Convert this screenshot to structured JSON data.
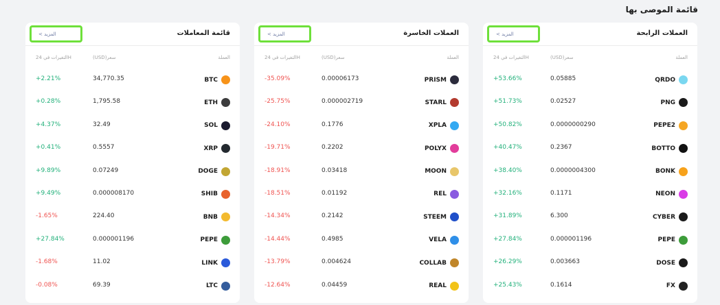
{
  "page_title": "قائمة الموصى بها",
  "panels": [
    {
      "title": "العملات الرابحة",
      "more_label": "< المزيد",
      "col_coin": "العملة",
      "col_price": "(USD)سعر",
      "col_change": "التغيرات في 24H",
      "rows": [
        {
          "symbol": "QRDO",
          "price": "0.05885",
          "change": "+53.66%",
          "dir": "pos",
          "icon": "qrdo-icon",
          "color": "#7ad7f0"
        },
        {
          "symbol": "PNG",
          "price": "0.02527",
          "change": "+51.73%",
          "dir": "pos",
          "icon": "png-icon",
          "color": "#1a1a1a"
        },
        {
          "symbol": "PEPE2",
          "price": "0.0000000290",
          "change": "+50.82%",
          "dir": "pos",
          "icon": "pepe2-icon",
          "color": "#f5a623"
        },
        {
          "symbol": "BOTTO",
          "price": "0.2367",
          "change": "+40.47%",
          "dir": "pos",
          "icon": "botto-icon",
          "color": "#111111"
        },
        {
          "symbol": "BONK",
          "price": "0.0000004300",
          "change": "+38.40%",
          "dir": "pos",
          "icon": "bonk-icon",
          "color": "#f7a21b"
        },
        {
          "symbol": "NEON",
          "price": "0.1171",
          "change": "+32.16%",
          "dir": "pos",
          "icon": "neon-icon",
          "color": "#d93be6"
        },
        {
          "symbol": "CYBER",
          "price": "6.300",
          "change": "+31.89%",
          "dir": "pos",
          "icon": "cyber-icon",
          "color": "#1a1a1a"
        },
        {
          "symbol": "PEPE",
          "price": "0.000001196",
          "change": "+27.84%",
          "dir": "pos",
          "icon": "pepe-icon",
          "color": "#3d9c3a"
        },
        {
          "symbol": "DOSE",
          "price": "0.003663",
          "change": "+26.29%",
          "dir": "pos",
          "icon": "dose-icon",
          "color": "#1a1a1a"
        },
        {
          "symbol": "FX",
          "price": "0.1614",
          "change": "+25.43%",
          "dir": "pos",
          "icon": "fx-icon",
          "color": "#222222"
        }
      ]
    },
    {
      "title": "العملات الخاسرة",
      "more_label": "< المزيد",
      "col_coin": "العملة",
      "col_price": "(USD)سعر",
      "col_change": "التغيرات في 24H",
      "rows": [
        {
          "symbol": "PRISM",
          "price": "0.00006173",
          "change": "-35.09%",
          "dir": "neg",
          "icon": "prism-icon",
          "color": "#2b2b3c"
        },
        {
          "symbol": "STARL",
          "price": "0.000002719",
          "change": "-25.75%",
          "dir": "neg",
          "icon": "starl-icon",
          "color": "#b33a2e"
        },
        {
          "symbol": "XPLA",
          "price": "0.1776",
          "change": "-24.10%",
          "dir": "neg",
          "icon": "xpla-icon",
          "color": "#33a9f2"
        },
        {
          "symbol": "POLYX",
          "price": "0.2202",
          "change": "-19.71%",
          "dir": "neg",
          "icon": "polyx-icon",
          "color": "#e23d9b"
        },
        {
          "symbol": "MOON",
          "price": "0.03418",
          "change": "-18.91%",
          "dir": "neg",
          "icon": "moon-icon",
          "color": "#e8c66a"
        },
        {
          "symbol": "REL",
          "price": "0.01192",
          "change": "-18.51%",
          "dir": "neg",
          "icon": "rel-icon",
          "color": "#8a5be0"
        },
        {
          "symbol": "STEEM",
          "price": "0.2142",
          "change": "-14.34%",
          "dir": "neg",
          "icon": "steem-icon",
          "color": "#1f4fc9"
        },
        {
          "symbol": "VELA",
          "price": "0.4985",
          "change": "-14.44%",
          "dir": "neg",
          "icon": "vela-icon",
          "color": "#2f8fe8"
        },
        {
          "symbol": "COLLAB",
          "price": "0.004624",
          "change": "-13.79%",
          "dir": "neg",
          "icon": "collab-icon",
          "color": "#c0862a"
        },
        {
          "symbol": "REAL",
          "price": "0.04459",
          "change": "-12.64%",
          "dir": "neg",
          "icon": "real-icon",
          "color": "#f2c318"
        }
      ]
    },
    {
      "title": "قائمة المعاملات",
      "more_label": "< المزيد",
      "col_coin": "العملة",
      "col_price": "(USD)سعر",
      "col_change": "التغيرات في 24H",
      "rows": [
        {
          "symbol": "BTC",
          "price": "34,770.35",
          "change": "+2.21%",
          "dir": "pos",
          "icon": "btc-icon",
          "color": "#f7931a"
        },
        {
          "symbol": "ETH",
          "price": "1,795.58",
          "change": "+0.28%",
          "dir": "pos",
          "icon": "eth-icon",
          "color": "#3c3c3d"
        },
        {
          "symbol": "SOL",
          "price": "32.49",
          "change": "+4.37%",
          "dir": "pos",
          "icon": "sol-icon",
          "color": "#1a1a2e"
        },
        {
          "symbol": "XRP",
          "price": "0.5557",
          "change": "+0.41%",
          "dir": "pos",
          "icon": "xrp-icon",
          "color": "#23292f"
        },
        {
          "symbol": "DOGE",
          "price": "0.07249",
          "change": "+9.89%",
          "dir": "pos",
          "icon": "doge-icon",
          "color": "#c2a633"
        },
        {
          "symbol": "SHIB",
          "price": "0.000008170",
          "change": "+9.49%",
          "dir": "pos",
          "icon": "shib-icon",
          "color": "#e8622c"
        },
        {
          "symbol": "BNB",
          "price": "224.40",
          "change": "-1.65%",
          "dir": "neg",
          "icon": "bnb-icon",
          "color": "#f3ba2f"
        },
        {
          "symbol": "PEPE",
          "price": "0.000001196",
          "change": "+27.84%",
          "dir": "pos",
          "icon": "pepe-icon",
          "color": "#3d9c3a"
        },
        {
          "symbol": "LINK",
          "price": "11.02",
          "change": "-1.68%",
          "dir": "neg",
          "icon": "link-icon",
          "color": "#2a5ada"
        },
        {
          "symbol": "LTC",
          "price": "69.39",
          "change": "-0.08%",
          "dir": "neg",
          "icon": "ltc-icon",
          "color": "#345d9d"
        }
      ]
    }
  ]
}
